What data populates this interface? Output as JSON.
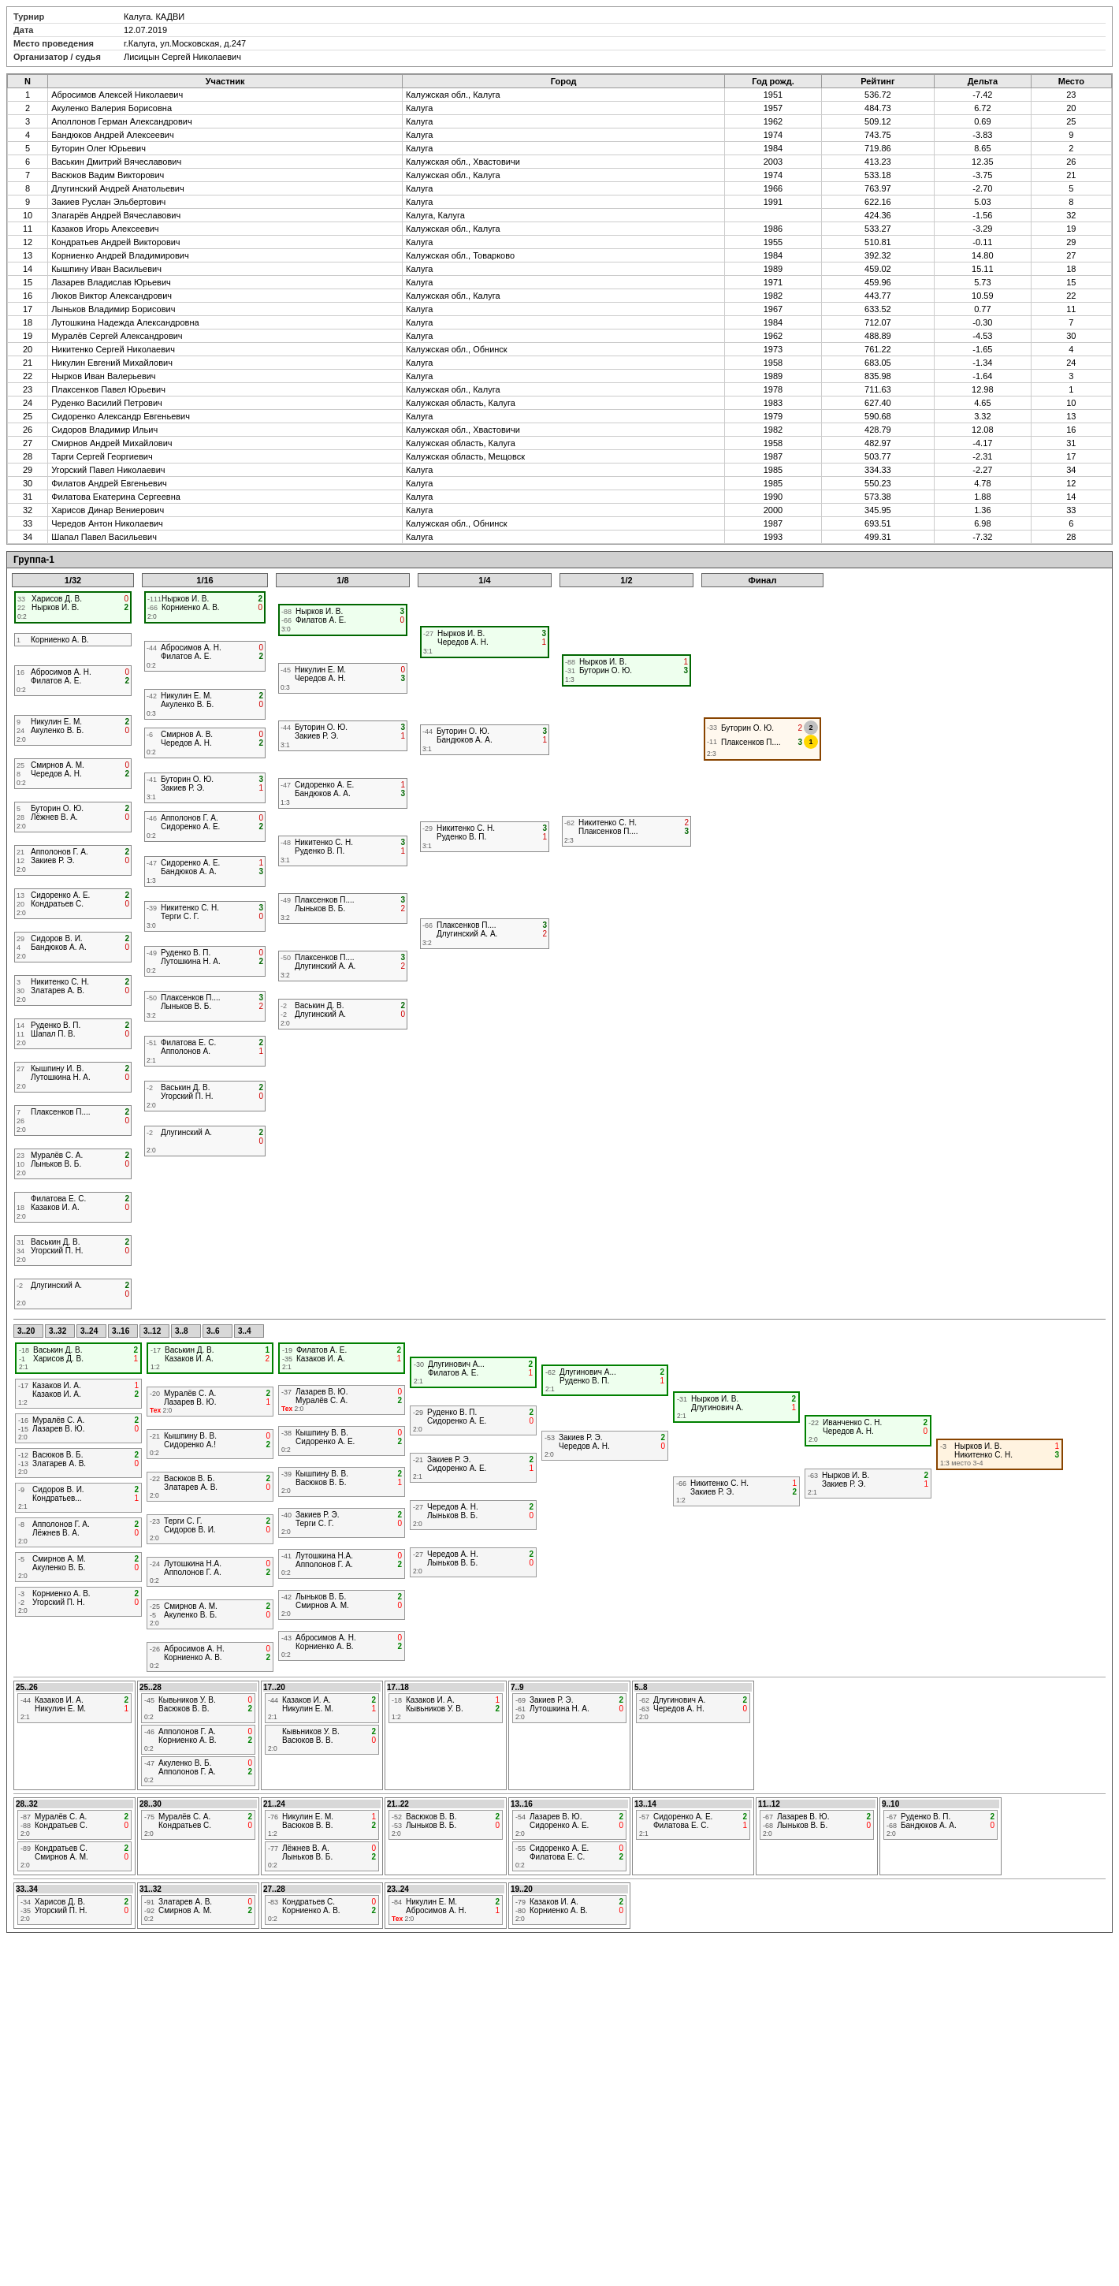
{
  "tournament": {
    "title": "Турнир",
    "title_value": "Калуга. КАДВИ",
    "date_label": "Дата",
    "date_value": "12.07.2019",
    "location_label": "Место проведения",
    "location_value": "г.Калуга, ул.Московская, д.247",
    "organizer_label": "Организатор / судья",
    "organizer_value": "Лисицын Сергей Николаевич"
  },
  "table_headers": [
    "N",
    "Участник",
    "Город",
    "Год рожд.",
    "Рейтинг",
    "Дельта",
    "Место"
  ],
  "participants": [
    [
      1,
      "Абросимов Алексей Николаевич",
      "Калужская обл., Калуга",
      1951,
      536.72,
      -7.42,
      23
    ],
    [
      2,
      "Акуленко Валерия Борисовна",
      "Калуга",
      1957,
      484.73,
      6.72,
      20
    ],
    [
      3,
      "Аполлонов Герман Александрович",
      "Калуга",
      1962,
      509.12,
      0.69,
      25
    ],
    [
      4,
      "Бандюков Андрей Алексеевич",
      "Калуга",
      1974,
      743.75,
      -3.83,
      9
    ],
    [
      5,
      "Буторин Олег Юрьевич",
      "Калуга",
      1984,
      719.86,
      8.65,
      2
    ],
    [
      6,
      "Васькин Дмитрий Вячеславович",
      "Калужская обл., Хвастовичи",
      2003,
      413.23,
      12.35,
      26
    ],
    [
      7,
      "Васюков Вадим Викторович",
      "Калужская обл., Калуга",
      1974,
      533.18,
      -3.75,
      21
    ],
    [
      8,
      "Длугинский Андрей Анатольевич",
      "Калуга",
      1966,
      763.97,
      -2.7,
      5
    ],
    [
      9,
      "Закиев Руслан Эльбертович",
      "Калуга",
      1991,
      622.16,
      5.03,
      8
    ],
    [
      10,
      "Злагарёв Андрей Вячеславович",
      "Калуга, Калуга",
      null,
      424.36,
      -1.56,
      32
    ],
    [
      11,
      "Казаков Игорь Алексеевич",
      "Калужская обл., Калуга",
      1986,
      533.27,
      -3.29,
      19
    ],
    [
      12,
      "Кондратьев Андрей Викторович",
      "Калуга",
      1955,
      510.81,
      -0.11,
      29
    ],
    [
      13,
      "Корниенко Андрей Владимирович",
      "Калужская обл., Товарково",
      1984,
      392.32,
      14.8,
      27
    ],
    [
      14,
      "Кышпину Иван Васильевич",
      "Калуга",
      1989,
      459.02,
      15.11,
      18
    ],
    [
      15,
      "Лазарев Владислав Юрьевич",
      "Калуга",
      1971,
      459.96,
      5.73,
      15
    ],
    [
      16,
      "Люков Виктор Александрович",
      "Калужская обл., Калуга",
      1982,
      443.77,
      10.59,
      22
    ],
    [
      17,
      "Лыньков Владимир Борисович",
      "Калуга",
      1967,
      633.52,
      0.77,
      11
    ],
    [
      18,
      "Лутошкина Надежда Александровна",
      "Калуга",
      1984,
      712.07,
      -0.3,
      7
    ],
    [
      19,
      "Муралёв Сергей Александрович",
      "Калуга",
      1962,
      488.89,
      -4.53,
      30
    ],
    [
      20,
      "Никитенко Сергей Николаевич",
      "Калужская обл., Обнинск",
      1973,
      761.22,
      -1.65,
      4
    ],
    [
      21,
      "Никулин Евгений Михайлович",
      "Калуга",
      1958,
      683.05,
      -1.34,
      24
    ],
    [
      22,
      "Нырков Иван Валерьевич",
      "Калуга",
      1989,
      835.98,
      -1.64,
      3
    ],
    [
      23,
      "Плаксенков Павел Юрьевич",
      "Калужская обл., Калуга",
      1978,
      711.63,
      12.98,
      1
    ],
    [
      24,
      "Руденко Василий Петрович",
      "Калужская область, Калуга",
      1983,
      627.4,
      4.65,
      10
    ],
    [
      25,
      "Сидоренко Александр Евгеньевич",
      "Калуга",
      1979,
      590.68,
      3.32,
      13
    ],
    [
      26,
      "Сидоров Владимир Ильич",
      "Калужская обл., Хвастовичи",
      1982,
      428.79,
      12.08,
      16
    ],
    [
      27,
      "Смирнов Андрей Михайлович",
      "Калужская область, Калуга",
      1958,
      482.97,
      -4.17,
      31
    ],
    [
      28,
      "Тарги Сергей Георгиевич",
      "Калужская область, Мещовск",
      1987,
      503.77,
      -2.31,
      17
    ],
    [
      29,
      "Угорский Павел Николаевич",
      "Калуга",
      1985,
      334.33,
      -2.27,
      34
    ],
    [
      30,
      "Филатов Андрей Евгеньевич",
      "Калуга",
      1985,
      550.23,
      4.78,
      12
    ],
    [
      31,
      "Филатова Екатерина Сергеевна",
      "Калуга",
      1990,
      573.38,
      1.88,
      14
    ],
    [
      32,
      "Харисов Динар Вениерович",
      "Калуга",
      2000,
      345.95,
      1.36,
      33
    ],
    [
      33,
      "Чередов Антон Николаевич",
      "Калужская обл., Обнинск",
      1987,
      693.51,
      6.98,
      6
    ],
    [
      34,
      "Шапал Павел Васильевич",
      "Калуга",
      1993,
      499.31,
      -7.32,
      28
    ]
  ],
  "group_label": "Группа-1",
  "stages": {
    "r32": "1/32",
    "r16": "1/16",
    "r8": "1/8",
    "r4": "1/4",
    "r2": "1/2",
    "final": "Финал"
  }
}
